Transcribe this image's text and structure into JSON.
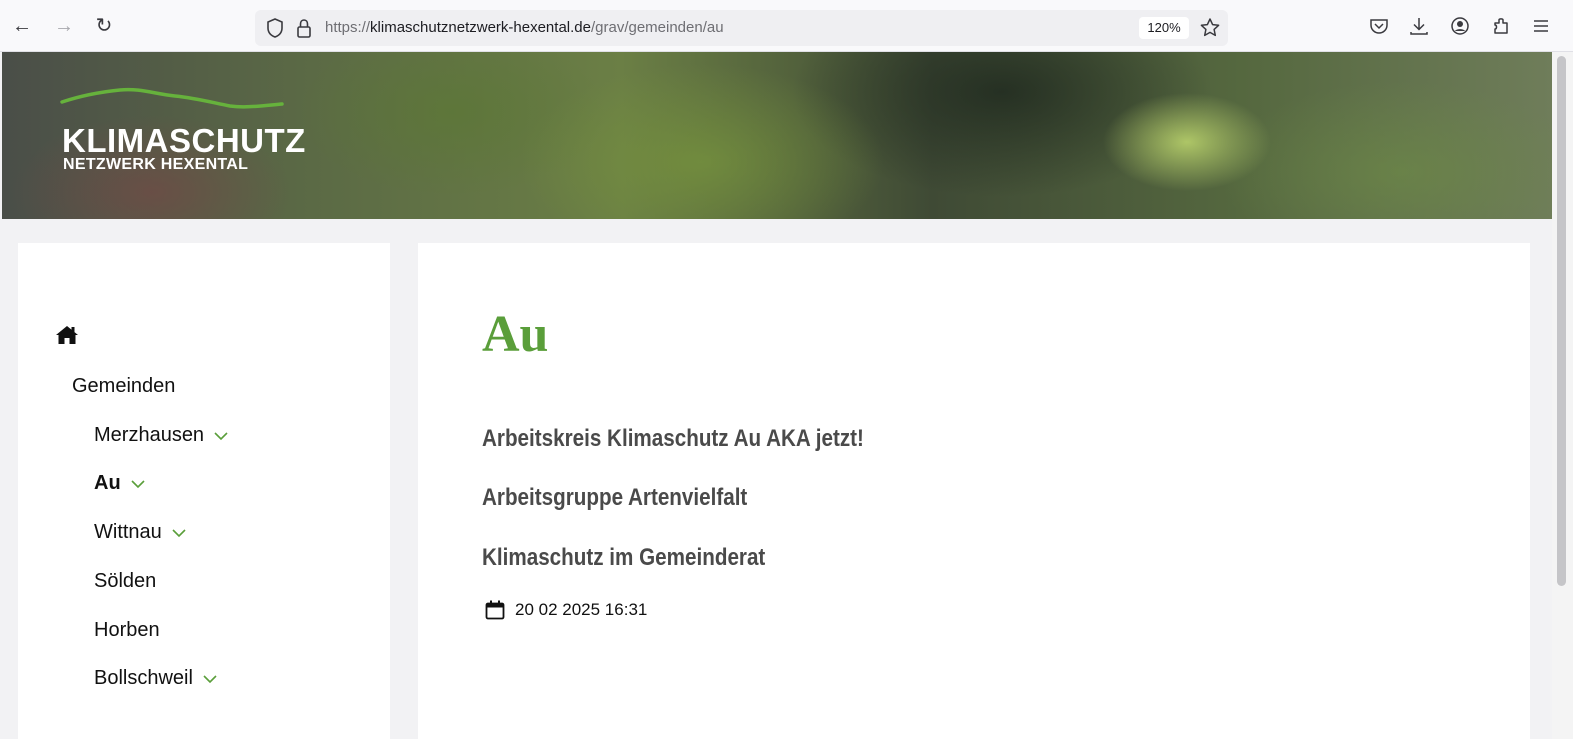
{
  "browser": {
    "url_prefix": "https://",
    "url_host": "klimaschutznetzwerk-hexental.de",
    "url_path": "/grav/gemeinden/au",
    "zoom": "120%"
  },
  "banner": {
    "logo_title": "KLIMASCHUTZ",
    "logo_subtitle": "NETZWERK HEXENTAL"
  },
  "sidebar": {
    "root_label": "Gemeinden",
    "items": [
      {
        "label": "Merzhausen",
        "has_submenu": true,
        "active": false
      },
      {
        "label": "Au",
        "has_submenu": true,
        "active": true
      },
      {
        "label": "Wittnau",
        "has_submenu": true,
        "active": false
      },
      {
        "label": "Sölden",
        "has_submenu": false,
        "active": false
      },
      {
        "label": "Horben",
        "has_submenu": false,
        "active": false
      },
      {
        "label": "Bollschweil",
        "has_submenu": true,
        "active": false
      }
    ]
  },
  "main": {
    "title": "Au",
    "links": [
      "Arbeitskreis Klimaschutz Au AKA jetzt!",
      "Arbeitsgruppe Artenvielfalt",
      "Klimaschutz im Gemeinderat"
    ],
    "date": "20 02 2025 16:31"
  },
  "colors": {
    "accent_green": "#5a9e3a",
    "link_gray": "#4a4a4a"
  }
}
